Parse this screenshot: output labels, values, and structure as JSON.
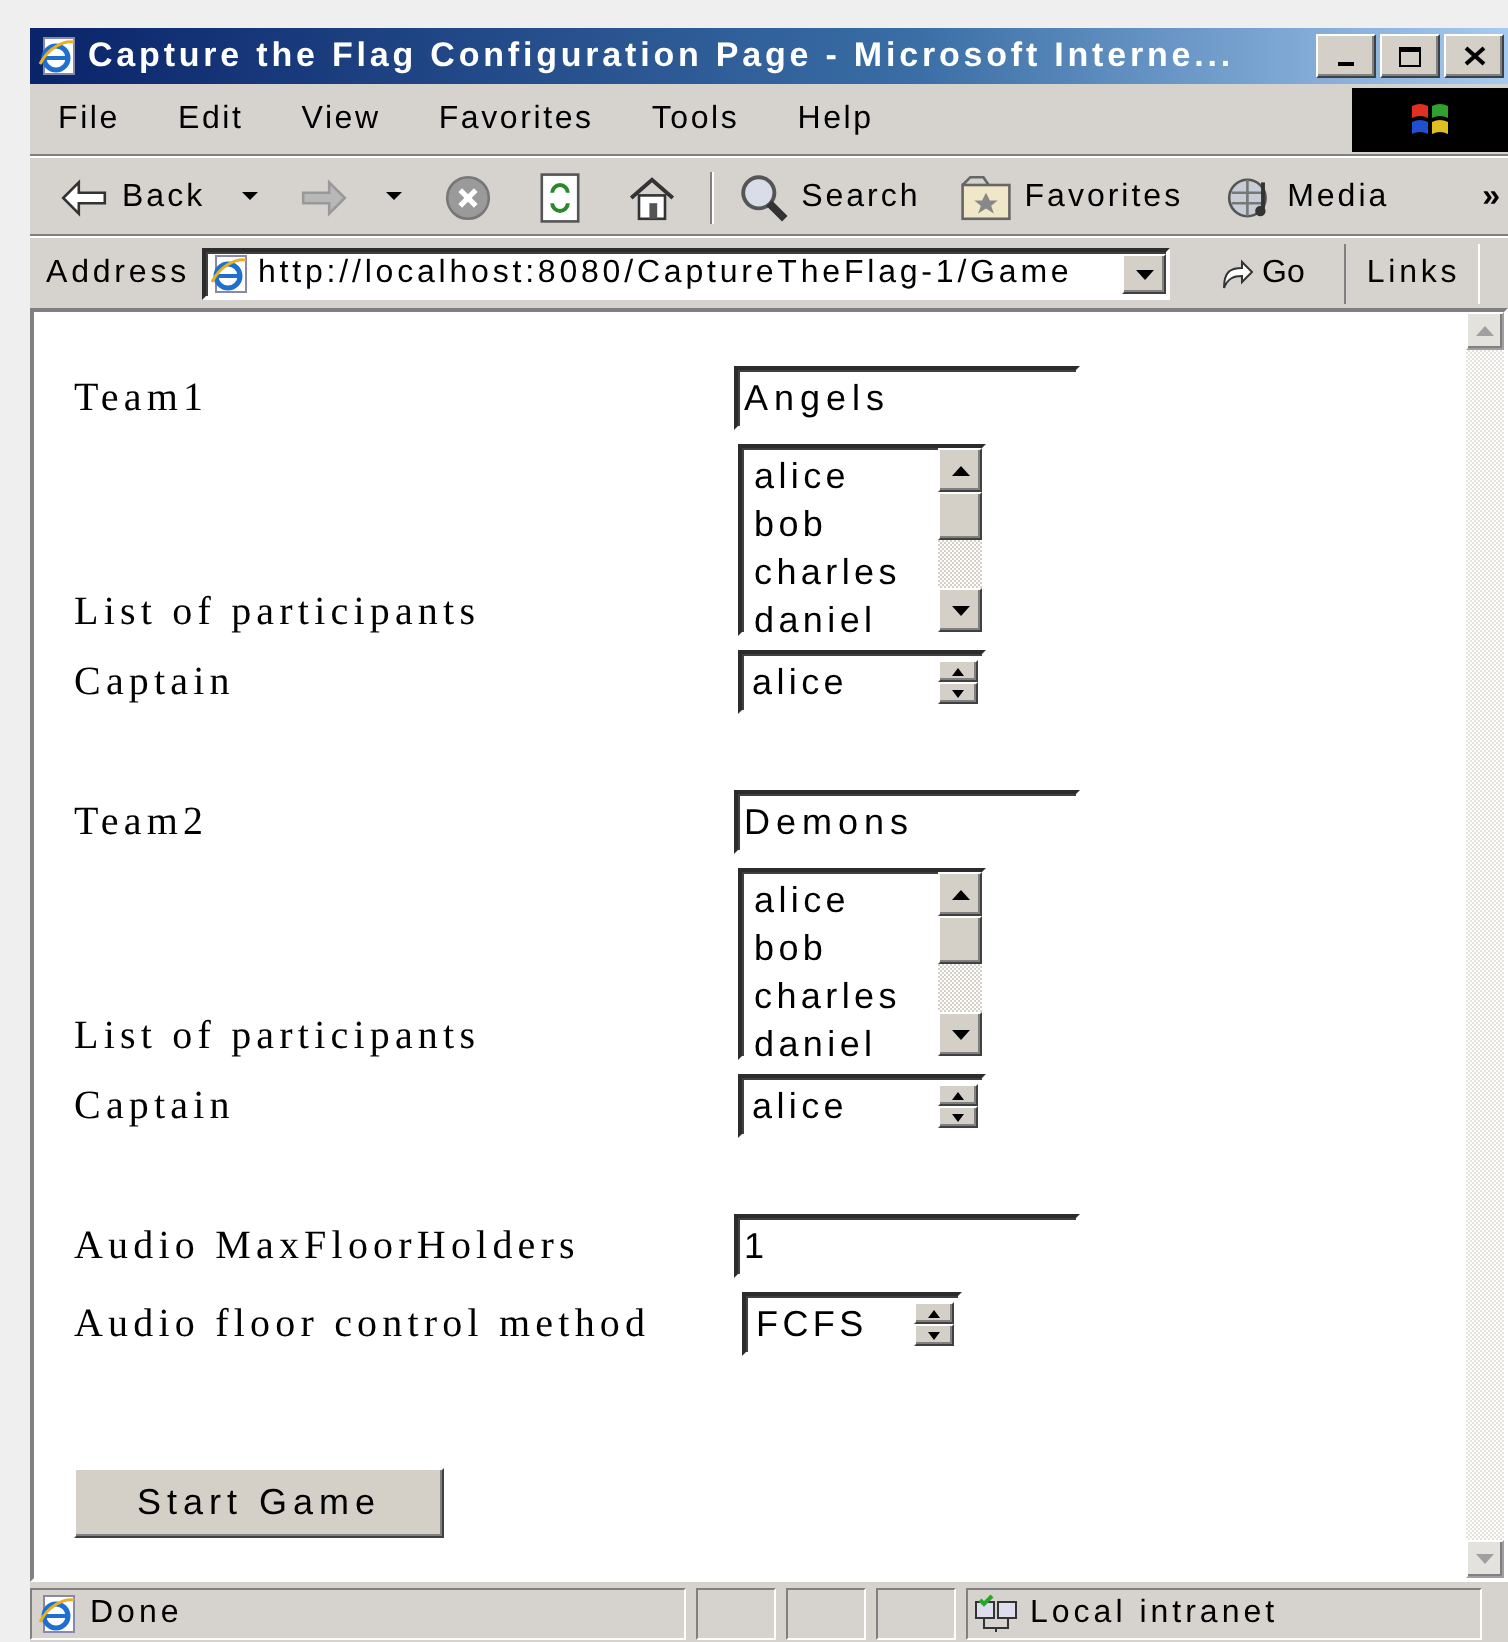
{
  "window": {
    "title": "Capture the Flag Configuration Page - Microsoft Interne..."
  },
  "menu": [
    "File",
    "Edit",
    "View",
    "Favorites",
    "Tools",
    "Help"
  ],
  "toolbar": [
    {
      "kind": "back",
      "label": "Back"
    },
    {
      "kind": "forward"
    },
    {
      "kind": "stop"
    },
    {
      "kind": "refresh"
    },
    {
      "kind": "home"
    },
    {
      "kind": "search",
      "label": "Search"
    },
    {
      "kind": "favorites",
      "label": "Favorites"
    },
    {
      "kind": "media",
      "label": "Media"
    }
  ],
  "toolbar_more": "»",
  "address": {
    "label": "Address",
    "value": "http://localhost:8080/CaptureTheFlag-1/Game",
    "go": "Go",
    "links": "Links"
  },
  "form": {
    "teams": [
      {
        "label": "Team1",
        "name": "Angels",
        "participants_label": "List of participants",
        "participants": [
          "alice",
          "bob",
          "charles",
          "daniel"
        ],
        "captain_label": "Captain",
        "captain": "alice"
      },
      {
        "label": "Team2",
        "name": "Demons",
        "participants_label": "List of participants",
        "participants": [
          "alice",
          "bob",
          "charles",
          "daniel"
        ],
        "captain_label": "Captain",
        "captain": "alice"
      }
    ],
    "max_holders": {
      "label": "Audio MaxFloorHolders",
      "value": "1"
    },
    "floor_method": {
      "label": "Audio floor control method",
      "value": "FCFS"
    },
    "submit": "Start Game"
  },
  "status_bar": {
    "text": "Done",
    "zone": "Local intranet"
  }
}
